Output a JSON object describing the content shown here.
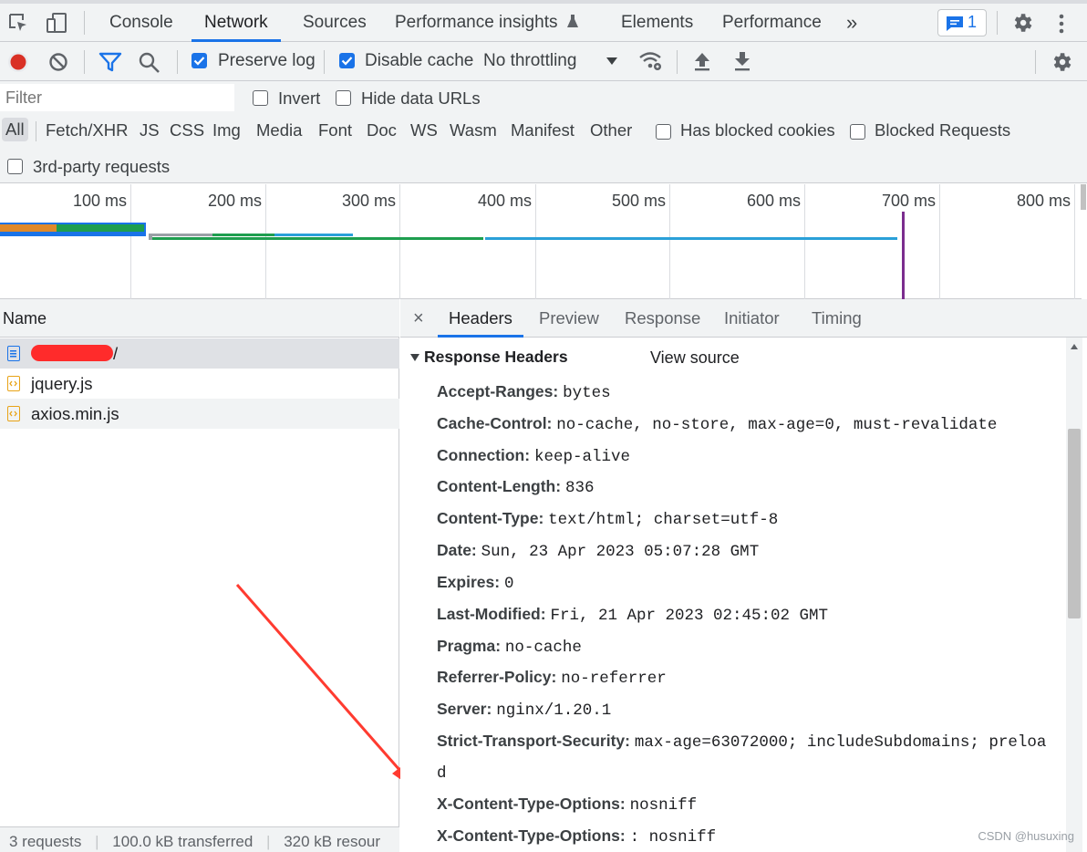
{
  "tabs": [
    "Console",
    "Network",
    "Sources",
    "Performance insights",
    "Elements",
    "Performance"
  ],
  "issues_count": "1",
  "toolbar": {
    "preserve_log": "Preserve log",
    "disable_cache": "Disable cache",
    "throttling": "No throttling"
  },
  "filter": {
    "placeholder": "Filter",
    "invert": "Invert",
    "hide_data_urls": "Hide data URLs",
    "types": [
      "All",
      "Fetch/XHR",
      "JS",
      "CSS",
      "Img",
      "Media",
      "Font",
      "Doc",
      "WS",
      "Wasm",
      "Manifest",
      "Other"
    ],
    "has_blocked_cookies": "Has blocked cookies",
    "blocked_requests": "Blocked Requests",
    "third_party": "3rd-party requests"
  },
  "overview": {
    "ticks": [
      "100 ms",
      "200 ms",
      "300 ms",
      "400 ms",
      "500 ms",
      "600 ms",
      "700 ms",
      "800 ms"
    ]
  },
  "requests": {
    "column": "Name",
    "items": [
      "/",
      "jquery.js",
      "axios.min.js"
    ]
  },
  "status": {
    "requests": "3 requests",
    "transferred": "100.0 kB transferred",
    "resources": "320 kB resour"
  },
  "detail": {
    "close": "×",
    "tabs": [
      "Headers",
      "Preview",
      "Response",
      "Initiator",
      "Timing"
    ],
    "section_title": "Response Headers",
    "view_source": "View source",
    "headers": [
      {
        "k": "Accept-Ranges:",
        "v": "bytes"
      },
      {
        "k": "Cache-Control:",
        "v": "no-cache, no-store, max-age=0, must-revalidate"
      },
      {
        "k": "Connection:",
        "v": "keep-alive"
      },
      {
        "k": "Content-Length:",
        "v": "836"
      },
      {
        "k": "Content-Type:",
        "v": "text/html; charset=utf-8"
      },
      {
        "k": "Date:",
        "v": "Sun, 23 Apr 2023 05:07:28 GMT"
      },
      {
        "k": "Expires:",
        "v": "0"
      },
      {
        "k": "Last-Modified:",
        "v": "Fri, 21 Apr 2023 02:45:02 GMT"
      },
      {
        "k": "Pragma:",
        "v": "no-cache"
      },
      {
        "k": "Referrer-Policy:",
        "v": "no-referrer"
      },
      {
        "k": "Server:",
        "v": "nginx/1.20.1"
      },
      {
        "k": "Strict-Transport-Security:",
        "v": "max-age=63072000; includeSubdomains; preloa"
      },
      {
        "k": "",
        "v": "d"
      },
      {
        "k": "X-Content-Type-Options:",
        "v": "nosniff"
      },
      {
        "k": "X-Content-Type-Options:",
        "v": ": nosniff"
      }
    ]
  },
  "watermark": "CSDN @husuxing"
}
